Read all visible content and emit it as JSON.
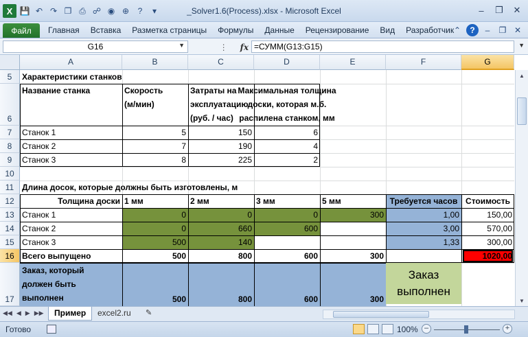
{
  "window": {
    "title": "_Solver1.6(Process).xlsx - Microsoft Excel",
    "app_icon": "X"
  },
  "ribbon": {
    "file_tab": "Файл",
    "tabs": [
      "Главная",
      "Вставка",
      "Разметка страницы",
      "Формулы",
      "Данные",
      "Рецензирование",
      "Вид",
      "Разработчик"
    ]
  },
  "formula_bar": {
    "name_box": "G16",
    "fx_label": "fx",
    "formula": "=СУММ(G13:G15)"
  },
  "columns": [
    "A",
    "B",
    "C",
    "D",
    "E",
    "F",
    "G"
  ],
  "selected_column": "G",
  "rows": [
    "5",
    "6",
    "7",
    "8",
    "9",
    "10",
    "11",
    "12",
    "13",
    "14",
    "15",
    "16",
    "17"
  ],
  "selected_row": "16",
  "cells": {
    "a5": "Характеристики станков",
    "a6": "Название станка",
    "b6_1": "Скорость",
    "b6_2": "(м/мин)",
    "c6_1": "Затраты на",
    "c6_2": "эксплуатацию",
    "c6_3": "(руб. / час)",
    "d6_1": "Максимальная толщина",
    "d6_2": "доски, которая м.б.",
    "d6_3": "распилена станком, мм",
    "a7": "Станок 1",
    "b7": "5",
    "c7": "150",
    "d7": "6",
    "a8": "Станок 2",
    "b8": "7",
    "c8": "190",
    "d8": "4",
    "a9": "Станок 3",
    "b9": "8",
    "c9": "225",
    "d9": "2",
    "a11": "Длина досок, которые должны быть изготовлены, м",
    "a12": "Толщина доски",
    "b12": "1 мм",
    "c12": "2 мм",
    "d12": "3 мм",
    "e12": "5 мм",
    "f12": "Требуется часов",
    "g12": "Стоимость",
    "a13": "Станок 1",
    "b13": "0",
    "c13": "0",
    "d13": "0",
    "e13": "300",
    "f13": "1,00",
    "g13": "150,00",
    "a14": "Станок 2",
    "b14": "0",
    "c14": "660",
    "d14": "600",
    "f14": "3,00",
    "g14": "570,00",
    "a15": "Станок 3",
    "b15": "500",
    "c15": "140",
    "f15": "1,33",
    "g15": "300,00",
    "a16": "Всего выпущено",
    "b16": "500",
    "c16": "800",
    "d16": "600",
    "e16": "300",
    "g16": "1020,00",
    "a17_1": "Заказ, который",
    "a17_2": "должен быть",
    "a17_3": "выполнен",
    "b17": "500",
    "c17": "800",
    "d17": "600",
    "e17": "300",
    "f16_1": "Заказ",
    "f16_2": "выполнен"
  },
  "sheets": {
    "active": "Пример",
    "other": "excel2.ru"
  },
  "status": {
    "ready": "Готово",
    "zoom": "100%"
  },
  "colors": {
    "green_fill": "#76923c",
    "blue_fill": "#95b3d7",
    "light_green": "#c3d69b",
    "red_fill": "#ff0000"
  }
}
